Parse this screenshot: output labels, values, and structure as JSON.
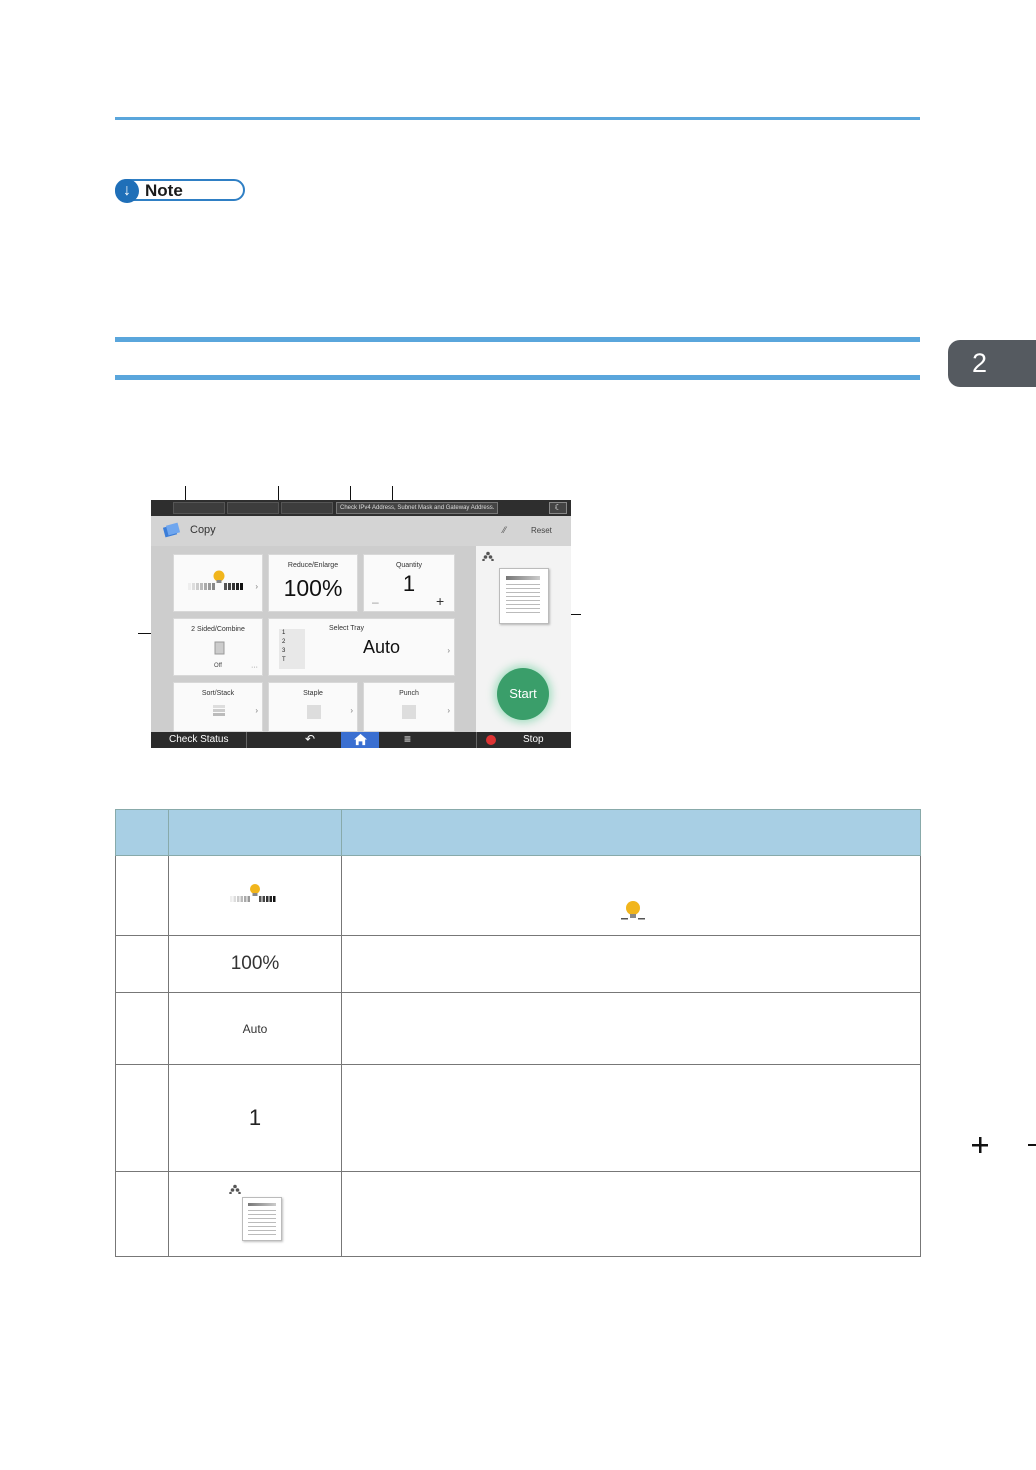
{
  "note": {
    "label": "Note"
  },
  "chapter_tab": {
    "number": "2"
  },
  "screen": {
    "topbar_message": "Check IPv4 Address, Subnet Mask and Gateway Address.",
    "app_title": "Copy",
    "reset_label": "Reset",
    "tiles": {
      "density": {
        "label": ""
      },
      "reduce_enlarge": {
        "label": "Reduce/Enlarge",
        "value": "100%"
      },
      "quantity": {
        "label": "Quantity",
        "value": "1",
        "minus": "–",
        "plus": "+"
      },
      "two_sided": {
        "label": "2 Sided/Combine",
        "value": "Off"
      },
      "select_tray": {
        "label": "Select Tray",
        "value": "Auto",
        "trays": [
          "1",
          "2",
          "3",
          "T"
        ]
      },
      "sort_stack": {
        "label": "Sort/Stack"
      },
      "staple": {
        "label": "Staple"
      },
      "punch": {
        "label": "Punch"
      }
    },
    "start_label": "Start",
    "check_status_label": "Check Status",
    "stop_label": "Stop"
  },
  "table": {
    "rows": [
      {
        "icon_text": ""
      },
      {
        "icon_text": "100%"
      },
      {
        "icon_text": "Auto"
      },
      {
        "icon_text": "1"
      },
      {
        "icon_text": ""
      }
    ]
  }
}
